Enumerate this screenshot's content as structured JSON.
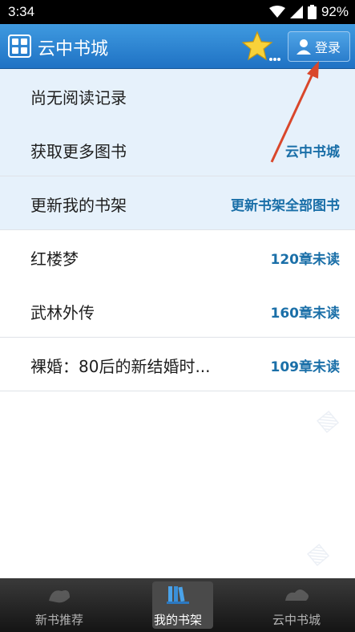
{
  "status_bar": {
    "time": "3:34",
    "battery_percent": "92%",
    "icons": [
      "wifi-icon",
      "signal-icon",
      "battery-icon"
    ]
  },
  "app_bar": {
    "title": "云中书城",
    "logo_icon": "grid-logo-icon",
    "favorite_icon": "star-icon",
    "login_label": "登录",
    "login_icon": "user-icon"
  },
  "rows": [
    {
      "title": "尚无阅读记录",
      "right": ""
    },
    {
      "title": "获取更多图书",
      "right": "云中书城"
    },
    {
      "title": "更新我的书架",
      "right": "更新书架全部图书"
    },
    {
      "title": "红楼梦",
      "right": "120章未读"
    },
    {
      "title": "武林外传",
      "right": "160章未读"
    },
    {
      "title": "裸婚：80后的新结婚时...",
      "right": "109章未读"
    }
  ],
  "tabs": [
    {
      "label": "新书推荐",
      "icon": "new-books-icon",
      "active": false
    },
    {
      "label": "我的书架",
      "icon": "bookshelf-icon",
      "active": true
    },
    {
      "label": "云中书城",
      "icon": "cloud-city-icon",
      "active": false
    }
  ],
  "colors": {
    "app_bar": "#2a82d2",
    "highlight_row": "#e6f1fb",
    "link_text": "#1a6fa8",
    "arrow": "#d9472b",
    "tab_bar": "#1c1c1c"
  }
}
